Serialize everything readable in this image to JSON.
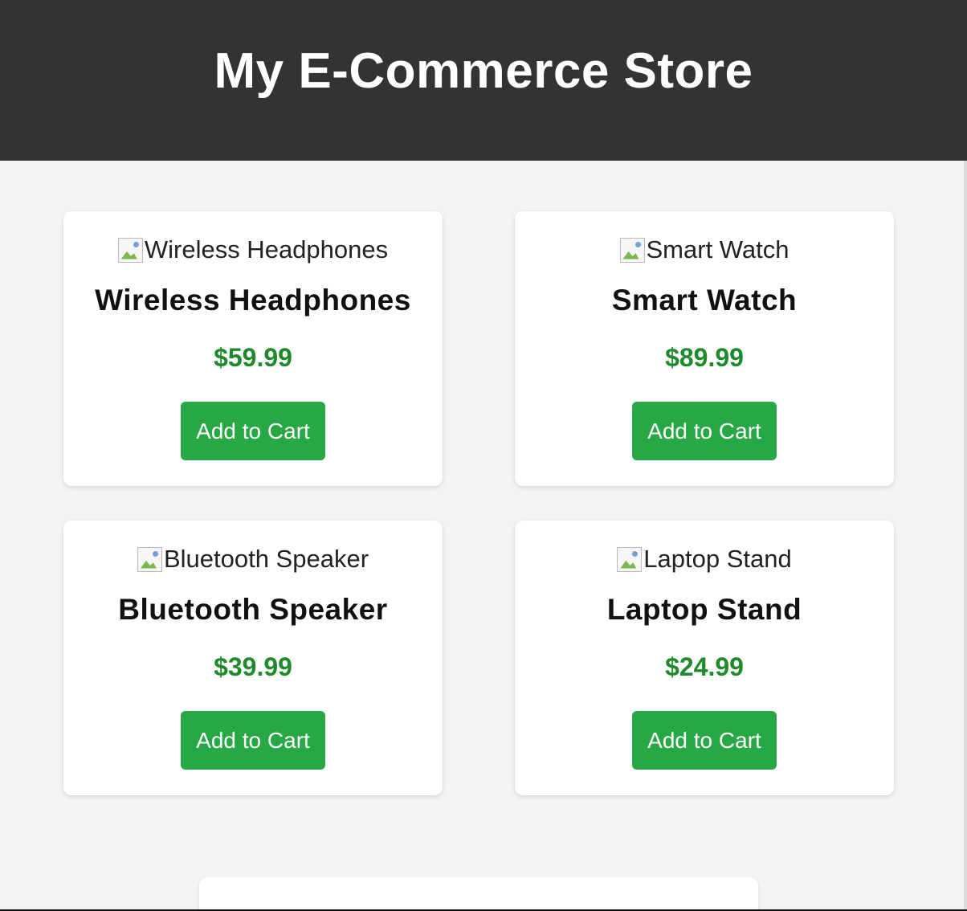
{
  "header": {
    "title": "My E-Commerce Store"
  },
  "products": [
    {
      "image_alt": "Wireless Headphones",
      "name": "Wireless Headphones",
      "price": "$59.99",
      "button_label": "Add to Cart"
    },
    {
      "image_alt": "Smart Watch",
      "name": "Smart Watch",
      "price": "$89.99",
      "button_label": "Add to Cart"
    },
    {
      "image_alt": "Bluetooth Speaker",
      "name": "Bluetooth Speaker",
      "price": "$39.99",
      "button_label": "Add to Cart"
    },
    {
      "image_alt": "Laptop Stand",
      "name": "Laptop Stand",
      "price": "$24.99",
      "button_label": "Add to Cart"
    }
  ],
  "colors": {
    "header_bg": "#333333",
    "page_bg": "#f4f4f4",
    "price_green": "#1f8a2c",
    "button_green": "#28a745"
  },
  "icons": {
    "product_image": "broken-image-icon"
  }
}
